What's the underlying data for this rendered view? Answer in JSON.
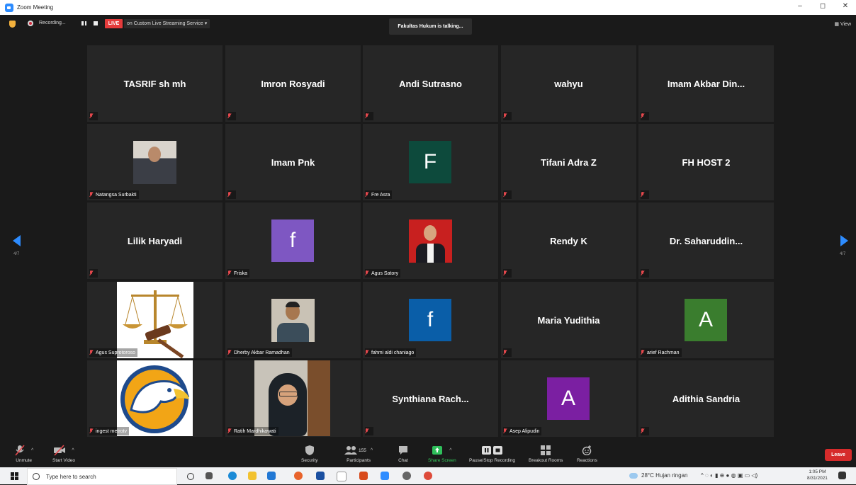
{
  "window": {
    "title": "Zoom Meeting",
    "controls": [
      "–",
      "◻",
      "✕"
    ]
  },
  "topbar": {
    "recording_label": "Recording...",
    "live_badge": "LIVE",
    "live_service": "on Custom Live Streaming Service ▾",
    "talking": "Fakultas Hukum is talking...",
    "view_label": "▦ View"
  },
  "pager": {
    "left": "4/7",
    "right": "4/7"
  },
  "tiles": [
    {
      "name": "TASRIF sh mh",
      "label": ""
    },
    {
      "name": "Imron Rosyadi",
      "label": ""
    },
    {
      "name": "Andi Sutrasno",
      "label": ""
    },
    {
      "name": "wahyu",
      "label": ""
    },
    {
      "name": "Imam Akbar Din...",
      "label": ""
    },
    {
      "name": "",
      "label": "Natangsa Surbakti"
    },
    {
      "name": "Imam Pnk",
      "label": ""
    },
    {
      "name": "",
      "label": "Fre Asra",
      "avatar": "F",
      "color": "#0d4a3c"
    },
    {
      "name": "Tifani Adra Z",
      "label": ""
    },
    {
      "name": "FH HOST 2",
      "label": ""
    },
    {
      "name": "Lilik Haryadi",
      "label": ""
    },
    {
      "name": "",
      "label": "Friska",
      "avatar": "f",
      "color": "#7e57c2"
    },
    {
      "name": "",
      "label": "Agus Satory"
    },
    {
      "name": "Rendy K",
      "label": ""
    },
    {
      "name": "Dr. Saharuddin...",
      "label": ""
    },
    {
      "name": "",
      "label": "Agus Suprotoroso"
    },
    {
      "name": "",
      "label": "Dherby Akbar Ramadhan"
    },
    {
      "name": "",
      "label": "fahmi aldi chaniago",
      "avatar": "f",
      "color": "#0a5ea8"
    },
    {
      "name": "Maria Yudithia",
      "label": ""
    },
    {
      "name": "",
      "label": "arief Rachman",
      "avatar": "A",
      "color": "#3a7d2e"
    },
    {
      "name": "",
      "label": "ingest metrotv"
    },
    {
      "name": "",
      "label": "Ratih Mardhikawati"
    },
    {
      "name": "Synthiana  Rach...",
      "label": ""
    },
    {
      "name": "",
      "label": "Asep Alipudin",
      "avatar": "A",
      "color": "#7b1fa2"
    },
    {
      "name": "Adithia Sandria",
      "label": ""
    }
  ],
  "toolbar": {
    "unmute": "Unmute",
    "start_video": "Start Video",
    "security": "Security",
    "participants": "Participants",
    "participants_count": "155",
    "chat": "Chat",
    "share_screen": "Share Screen",
    "pause_stop": "Pause/Stop Recording",
    "breakout": "Breakout Rooms",
    "reactions": "Reactions",
    "leave": "Leave"
  },
  "taskbar": {
    "search_placeholder": "Type here to search",
    "weather": "28°C  Hujan ringan",
    "time": "1:05 PM",
    "date": "8/31/2021"
  }
}
